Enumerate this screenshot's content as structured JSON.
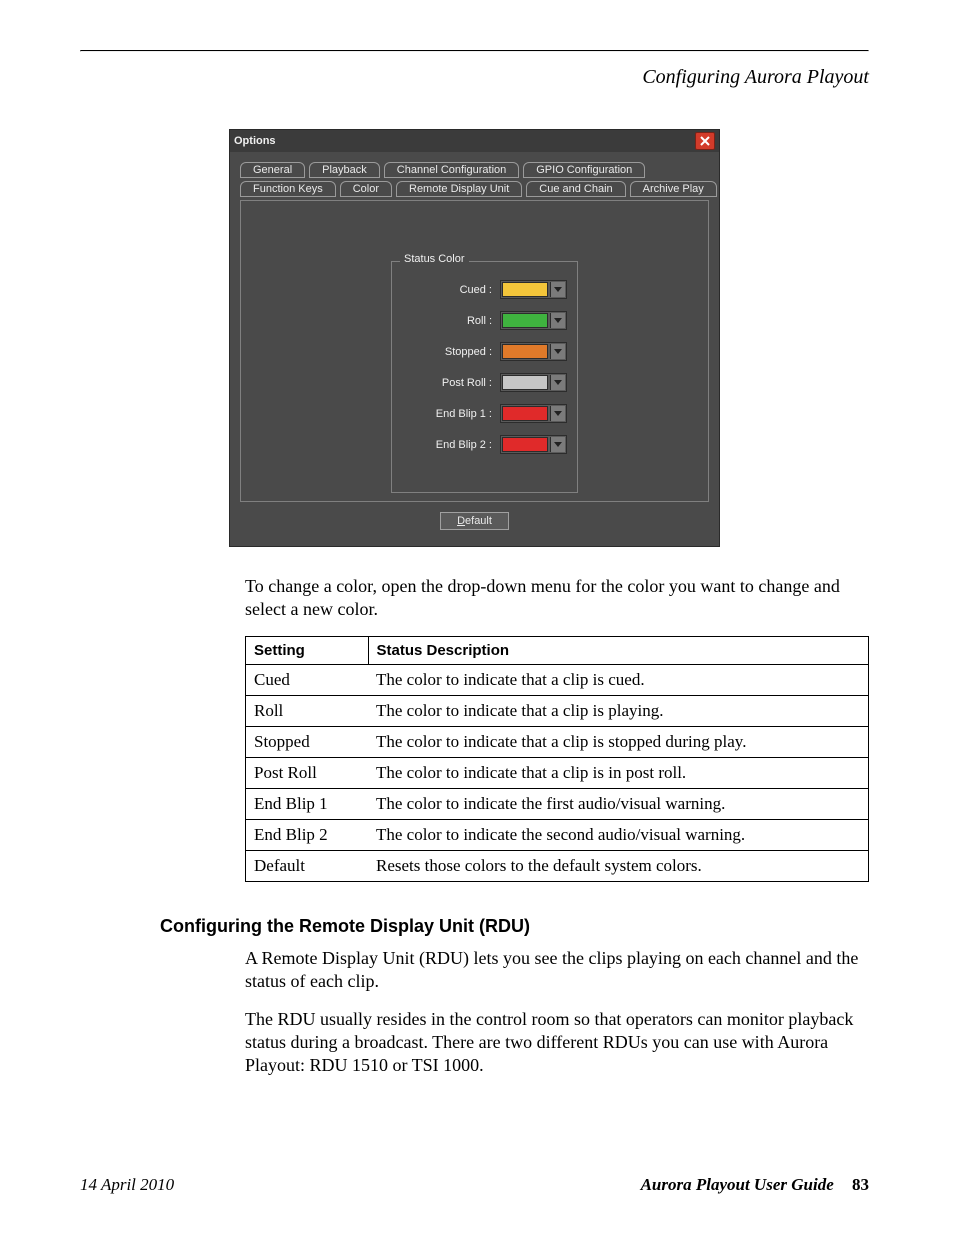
{
  "running_head": "Configuring Aurora Playout",
  "dialog": {
    "title": "Options",
    "tabs_row1": [
      "General",
      "Playback",
      "Channel Configuration",
      "GPIO Configuration"
    ],
    "tabs_row2": [
      "Function Keys",
      "Color",
      "Remote Display Unit",
      "Cue and Chain",
      "Archive Play"
    ],
    "group_title": "Status Color",
    "rows": [
      {
        "label": "Cued :",
        "color": "#f3c53a"
      },
      {
        "label": "Roll :",
        "color": "#3fb33f"
      },
      {
        "label": "Stopped :",
        "color": "#e07a2a"
      },
      {
        "label": "Post Roll :",
        "color": "#c6c6c6"
      },
      {
        "label": "End Blip 1 :",
        "color": "#e02a2a"
      },
      {
        "label": "End Blip 2 :",
        "color": "#e02a2a"
      }
    ],
    "default_button": "Default"
  },
  "intro_para": "To change a color, open the drop-down menu for the color you want to change and select a new color.",
  "table": {
    "headers": [
      "Setting",
      "Status Description"
    ],
    "rows": [
      [
        "Cued",
        "The color to indicate that a clip is cued."
      ],
      [
        "Roll",
        "The color to indicate that a clip is playing."
      ],
      [
        "Stopped",
        "The color to indicate that a clip is stopped during play."
      ],
      [
        "Post Roll",
        "The color to indicate that a clip is in post roll."
      ],
      [
        "End Blip 1",
        "The color to indicate the first audio/visual warning."
      ],
      [
        "End Blip 2",
        "The color to indicate the second audio/visual warning."
      ],
      [
        "Default",
        "Resets those colors to the default system colors."
      ]
    ]
  },
  "section_heading": "Configuring the Remote Display Unit (RDU)",
  "para1": "A Remote Display Unit (RDU) lets you see the clips playing on each channel and the status of each clip.",
  "para2": "The RDU usually resides in the control room so that operators can monitor playback status during a broadcast. There are two different RDUs you can use with Aurora Playout: RDU 1510 or TSI 1000.",
  "footer": {
    "date": "14  April  2010",
    "guide": "Aurora Playout User Guide",
    "page": "83"
  }
}
